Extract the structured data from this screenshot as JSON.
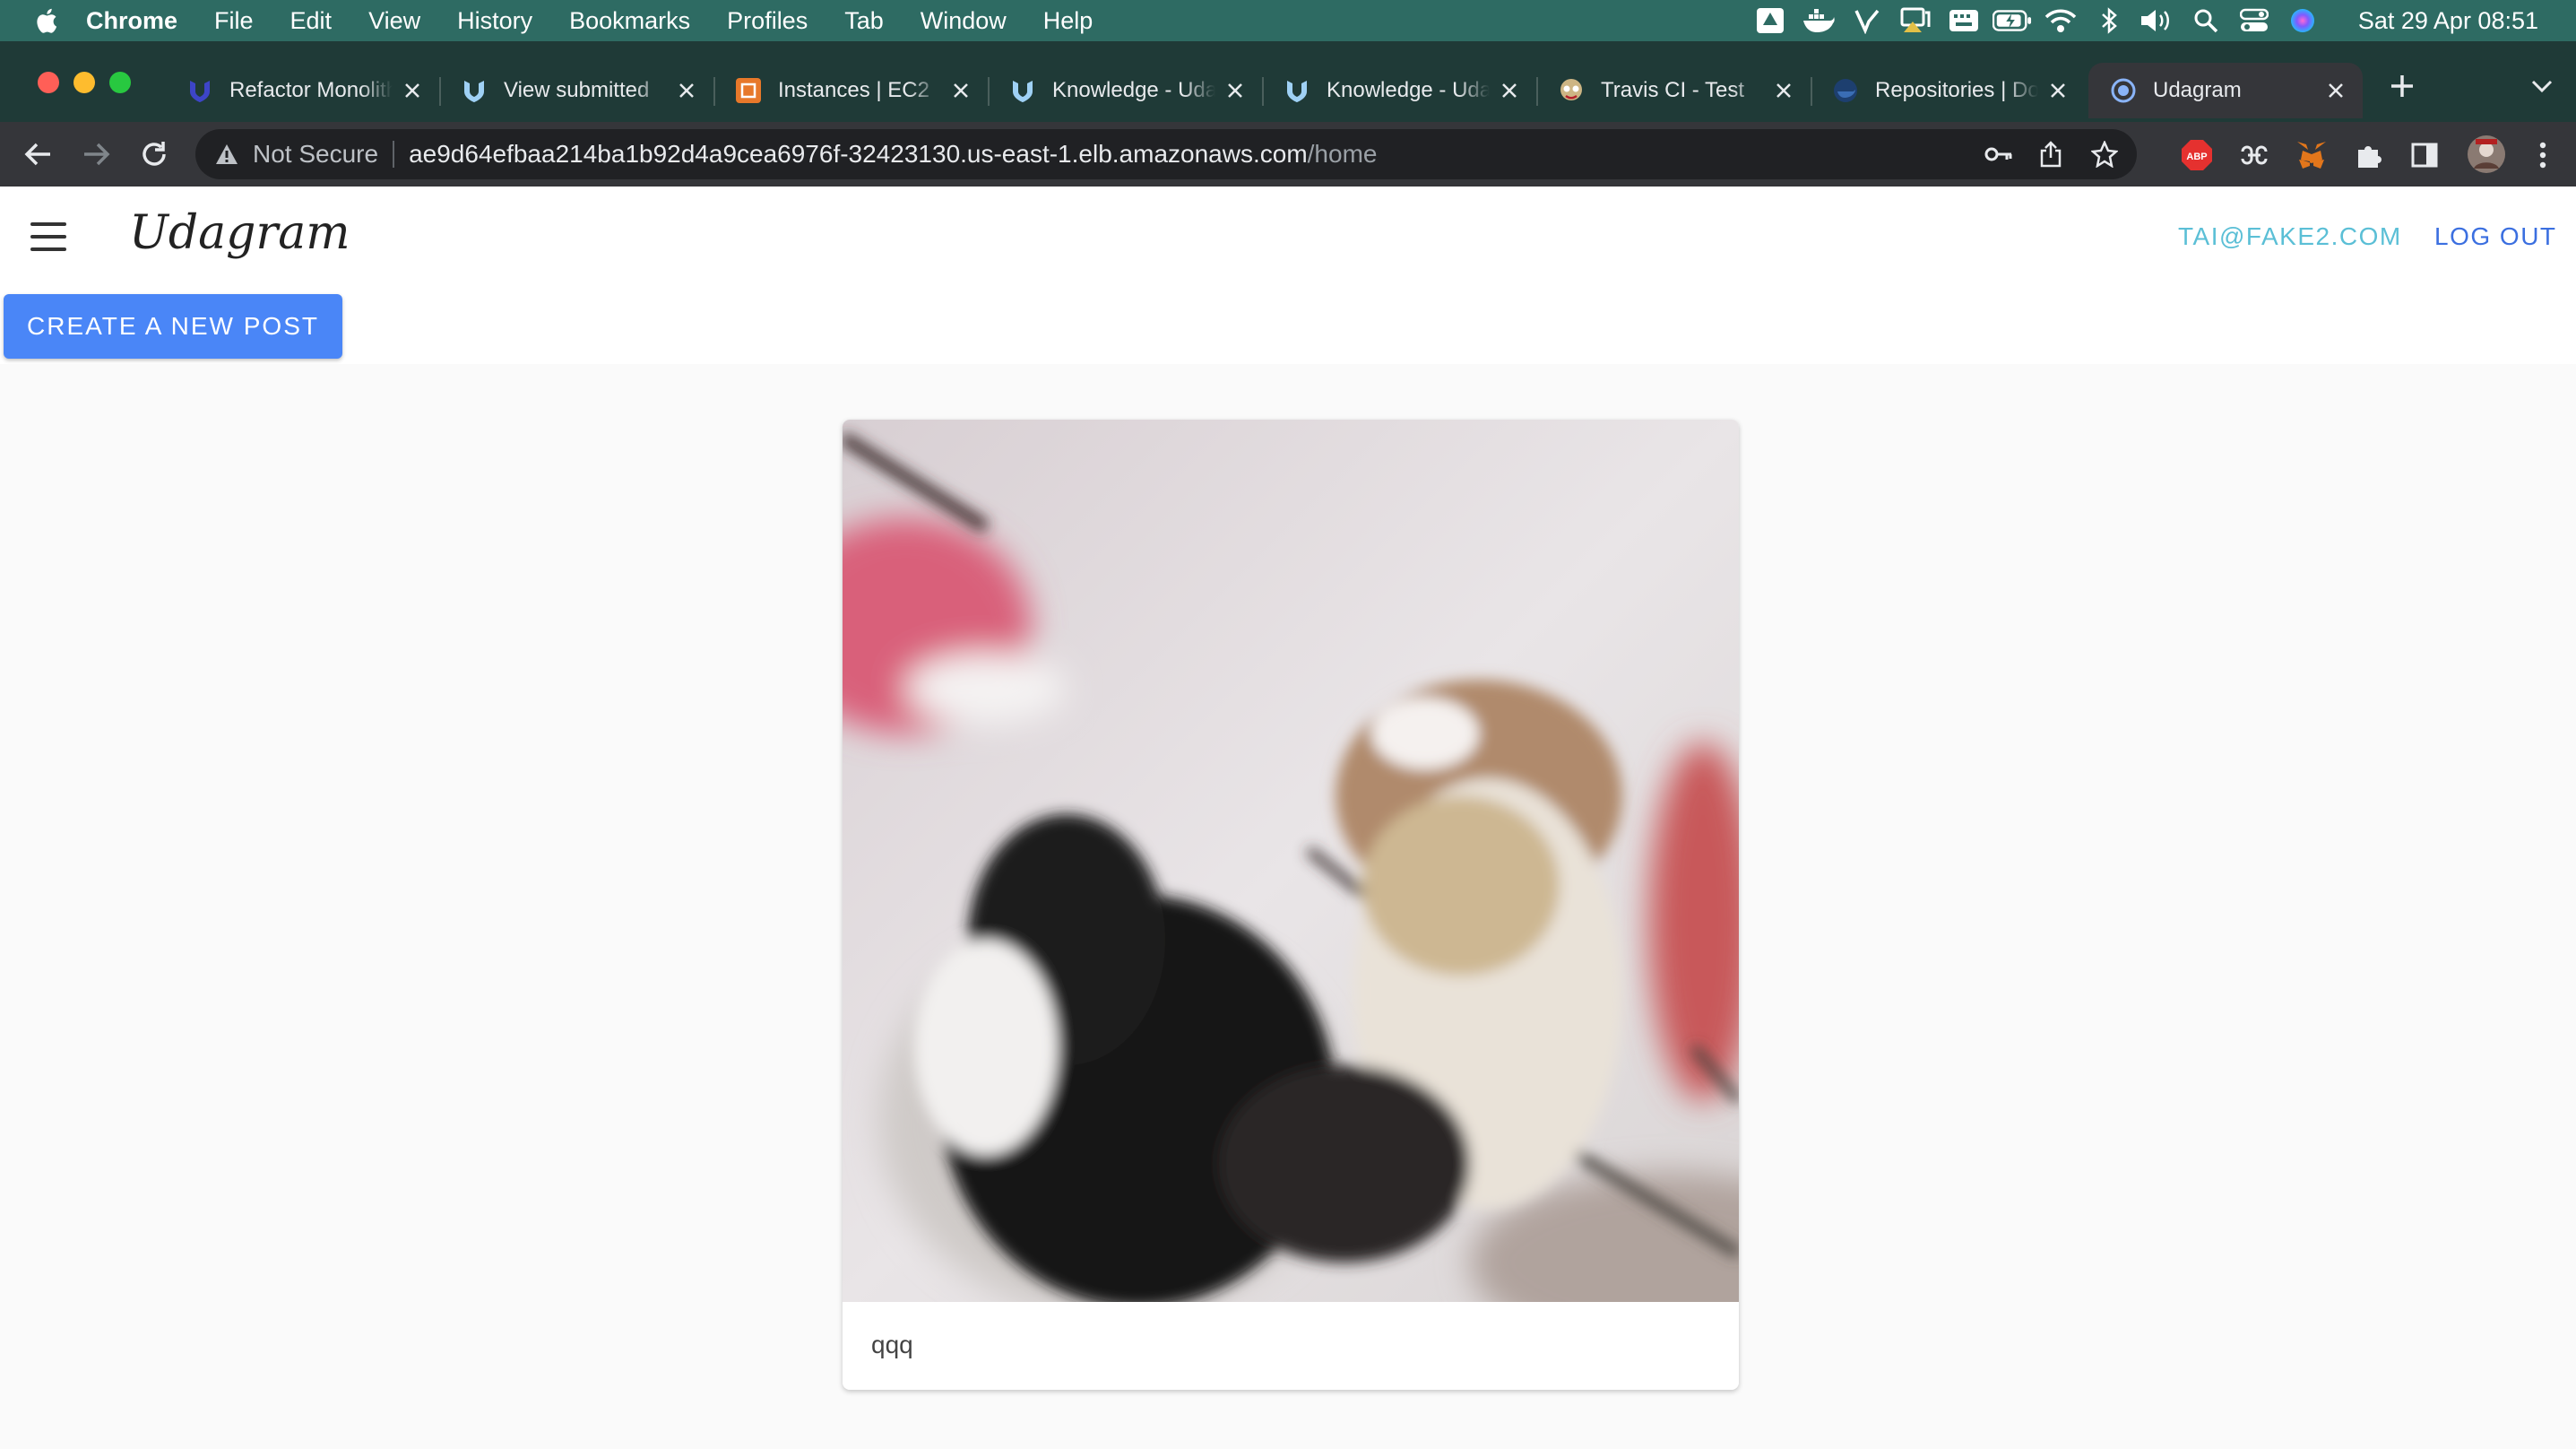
{
  "menubar": {
    "app": "Chrome",
    "items": [
      "File",
      "Edit",
      "View",
      "History",
      "Bookmarks",
      "Profiles",
      "Tab",
      "Window",
      "Help"
    ],
    "clock": "Sat 29 Apr  08:51"
  },
  "tabs": [
    {
      "label": "Refactor Monolith",
      "icon": "udacity-icon"
    },
    {
      "label": "View submitted",
      "icon": "udacity-icon"
    },
    {
      "label": "Instances | EC2",
      "icon": "aws-ec2-icon"
    },
    {
      "label": "Knowledge - Udacity",
      "icon": "udacity-icon"
    },
    {
      "label": "Knowledge - Udacity",
      "icon": "udacity-icon"
    },
    {
      "label": "Travis CI - Test",
      "icon": "travis-icon"
    },
    {
      "label": "Repositories | Docker",
      "icon": "docker-icon"
    },
    {
      "label": "Udagram",
      "icon": "globe-icon",
      "active": true
    }
  ],
  "toolbar": {
    "security_label": "Not Secure",
    "url_host": "ae9d64efbaa214ba1b92d4a9cea6976f-32423130.us-east-1.elb.amazonaws.com",
    "url_path": "/home"
  },
  "extensions": [
    "adblock-icon",
    "extension-icon",
    "metamask-icon",
    "puzzle-icon",
    "sidepanel-icon",
    "profile-avatar"
  ],
  "page": {
    "logo": "Udagram",
    "user_email": "TAI@FAKE2.COM",
    "logout_label": "LOG OUT",
    "create_post_label": "CREATE A NEW POST",
    "posts": [
      {
        "caption": "qqq",
        "image": "photo of two cats playing on a bed"
      }
    ]
  },
  "colors": {
    "menubar_bg": "#2e6b63",
    "accent_blue": "#4a86f7",
    "email_link": "#5bbfd6",
    "logout_link": "#3b6fe0"
  }
}
